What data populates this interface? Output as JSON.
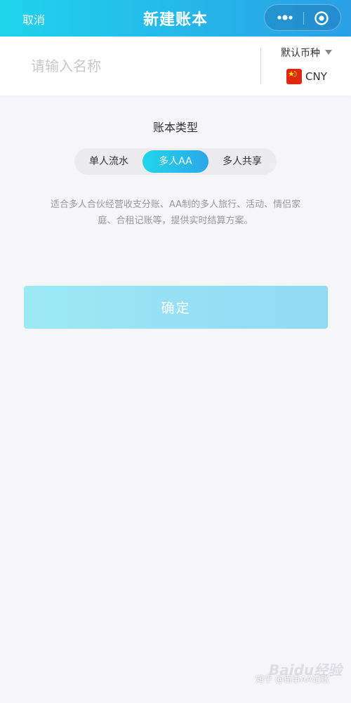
{
  "header": {
    "cancel_label": "取消",
    "title": "新建账本",
    "capsule": {
      "more_icon": "more-dots-icon",
      "close_icon": "record-circle-icon"
    },
    "colors": {
      "gradient_start": "#1fd3ec",
      "gradient_end": "#2a9fe6"
    }
  },
  "name_field": {
    "placeholder": "请输入名称",
    "value": ""
  },
  "currency": {
    "label": "默认币种",
    "flag_icon": "china-flag-icon",
    "code": "CNY"
  },
  "ledger_type": {
    "title": "账本类型",
    "options": [
      "单人流水",
      "多人AA",
      "多人共享"
    ],
    "selected": "多人AA",
    "description": "适合多人合伙经营收支分账、AA制的多人旅行、活动、情侣家庭、合租记账等，提供实时结算方案。"
  },
  "confirm_label": "确定",
  "watermark": {
    "brand": "Baidu经验",
    "text": "知乎 @百事AA记账"
  }
}
